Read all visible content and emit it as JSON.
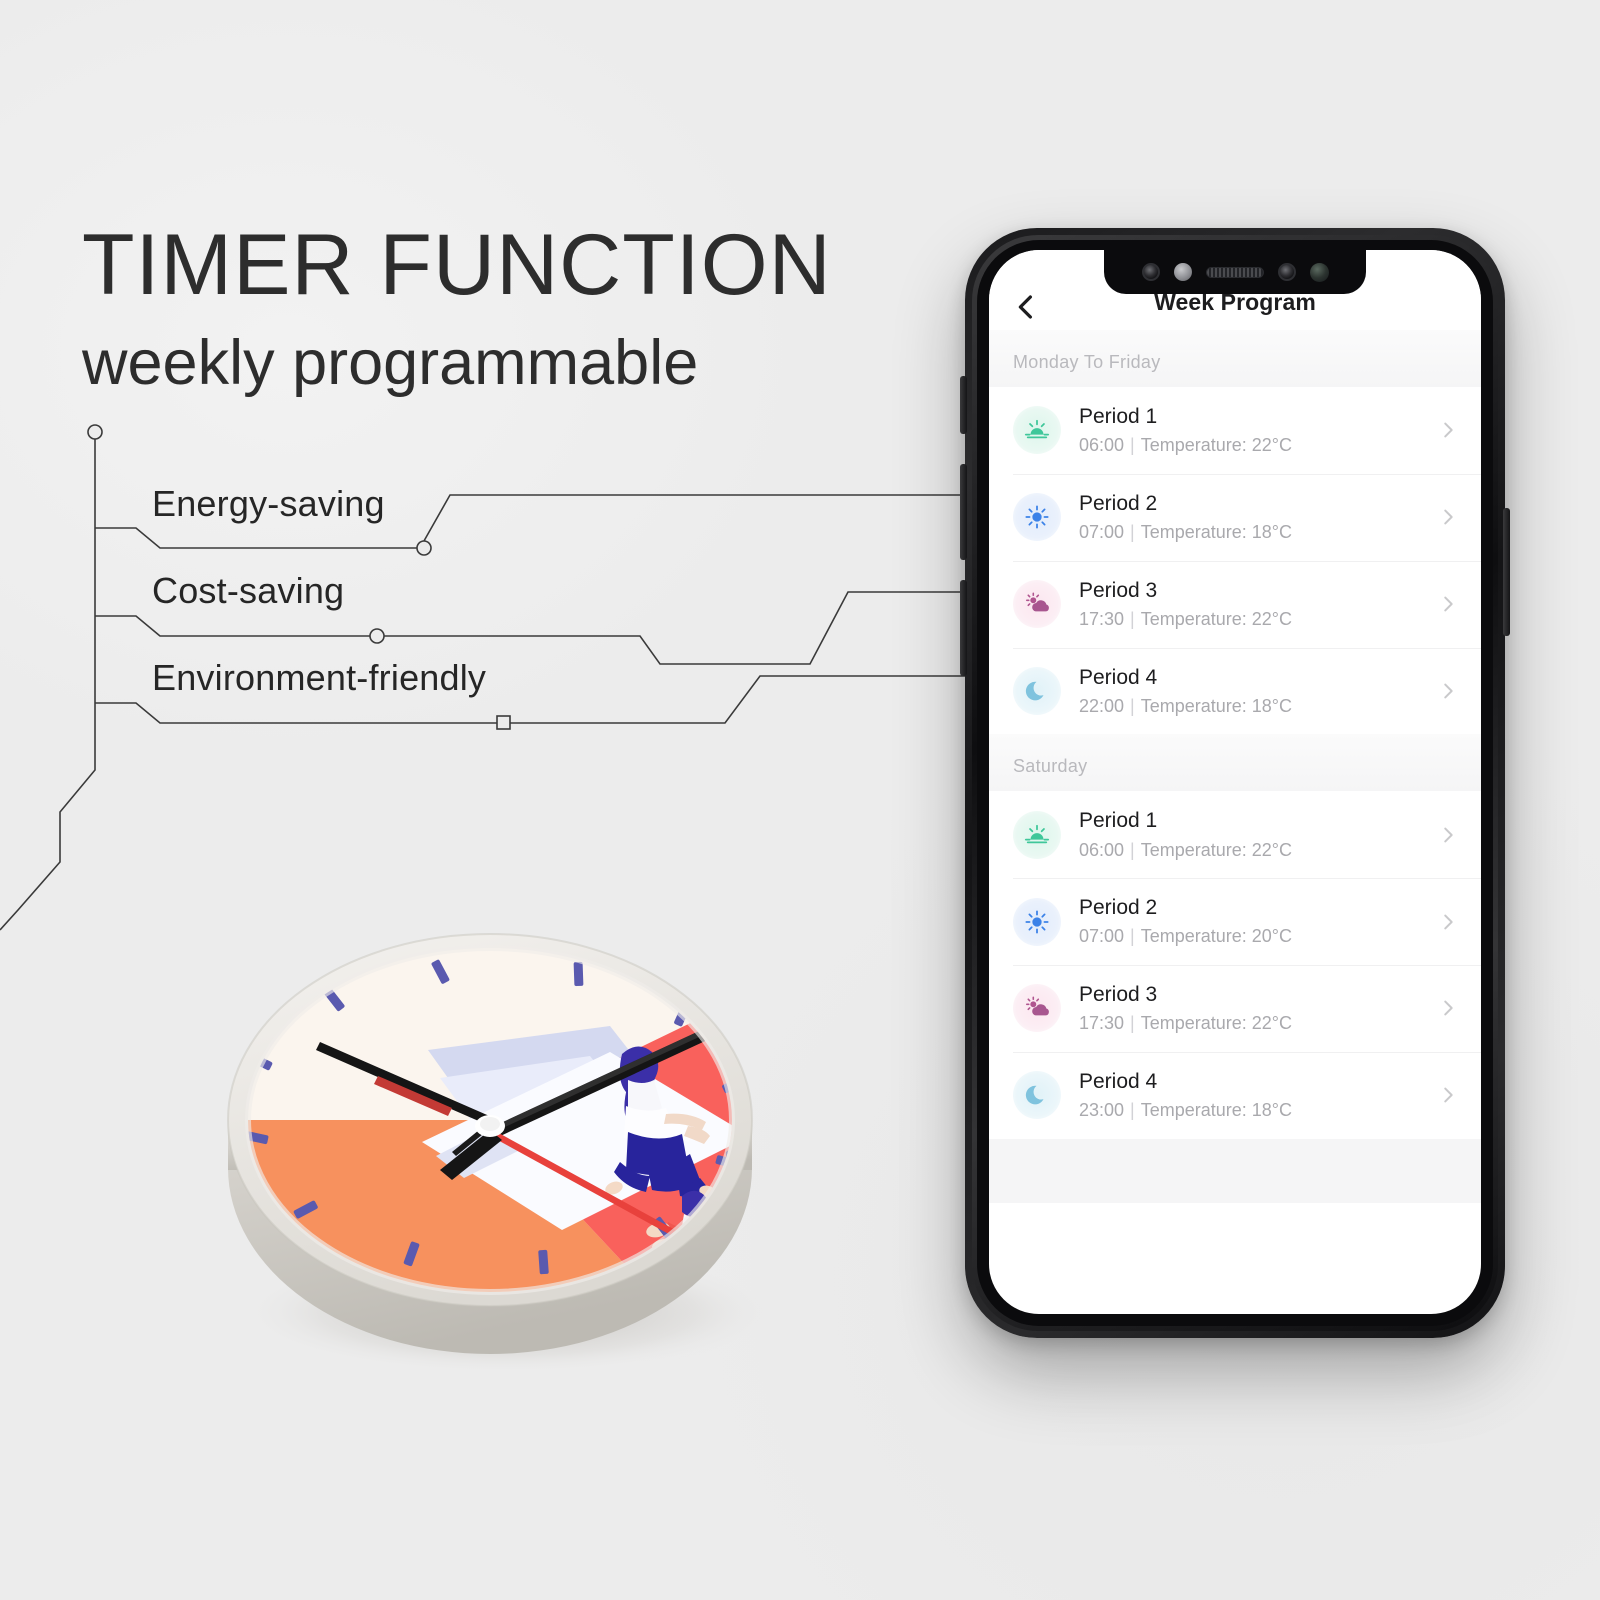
{
  "headline": {
    "title": "TIMER FUNCTION",
    "subtitle": "weekly programmable"
  },
  "features": [
    {
      "label": "Energy-saving"
    },
    {
      "label": "Cost-saving"
    },
    {
      "label": "Environment-friendly"
    }
  ],
  "phone": {
    "app": {
      "back_icon": "chevron-left-icon",
      "title": "Week Program",
      "sections": [
        {
          "header": "Monday To Friday",
          "rows": [
            {
              "icon": "sunrise-icon",
              "title": "Period 1",
              "time": "06:00",
              "separator": "|",
              "detail": "Temperature: 22°C",
              "chevron": "chevron-right-icon"
            },
            {
              "icon": "sun-icon",
              "title": "Period 2",
              "time": "07:00",
              "separator": "|",
              "detail": "Temperature: 18°C",
              "chevron": "chevron-right-icon"
            },
            {
              "icon": "cloud-sun-icon",
              "title": "Period 3",
              "time": "17:30",
              "separator": "|",
              "detail": "Temperature: 22°C",
              "chevron": "chevron-right-icon"
            },
            {
              "icon": "moon-icon",
              "title": "Period 4",
              "time": "22:00",
              "separator": "|",
              "detail": "Temperature: 18°C",
              "chevron": "chevron-right-icon"
            }
          ]
        },
        {
          "header": "Saturday",
          "rows": [
            {
              "icon": "sunrise-icon",
              "title": "Period 1",
              "time": "06:00",
              "separator": "|",
              "detail": "Temperature: 22°C",
              "chevron": "chevron-right-icon"
            },
            {
              "icon": "sun-icon",
              "title": "Period 2",
              "time": "07:00",
              "separator": "|",
              "detail": "Temperature: 20°C",
              "chevron": "chevron-right-icon"
            },
            {
              "icon": "cloud-sun-icon",
              "title": "Period 3",
              "time": "17:30",
              "separator": "|",
              "detail": "Temperature: 22°C",
              "chevron": "chevron-right-icon"
            },
            {
              "icon": "moon-icon",
              "title": "Period 4",
              "time": "23:00",
              "separator": "|",
              "detail": "Temperature: 18°C",
              "chevron": "chevron-right-icon"
            }
          ]
        }
      ]
    },
    "notch_sensors": [
      "camera-icon",
      "sensor-dot-icon",
      "speaker-grille-icon",
      "camera-icon",
      "lens-icon"
    ]
  },
  "clock": {
    "face_sectors": [
      "cream",
      "orange",
      "red"
    ],
    "illustration": "family-reading-on-mat"
  },
  "colors": {
    "background": "#ececec",
    "text_dark": "#2d2d2d",
    "line": "#3a3a3a",
    "clock_cream": "#fbf5ee",
    "clock_orange": "#f7915e",
    "clock_red": "#f9615c",
    "tick_blue": "#5a5aaf",
    "second_hand_red": "#e8413c",
    "icon_sunrise": "#3fc79a",
    "icon_sun": "#3b82e8",
    "icon_cloudsun": "#b0558f",
    "icon_moon": "#7fc3de"
  }
}
